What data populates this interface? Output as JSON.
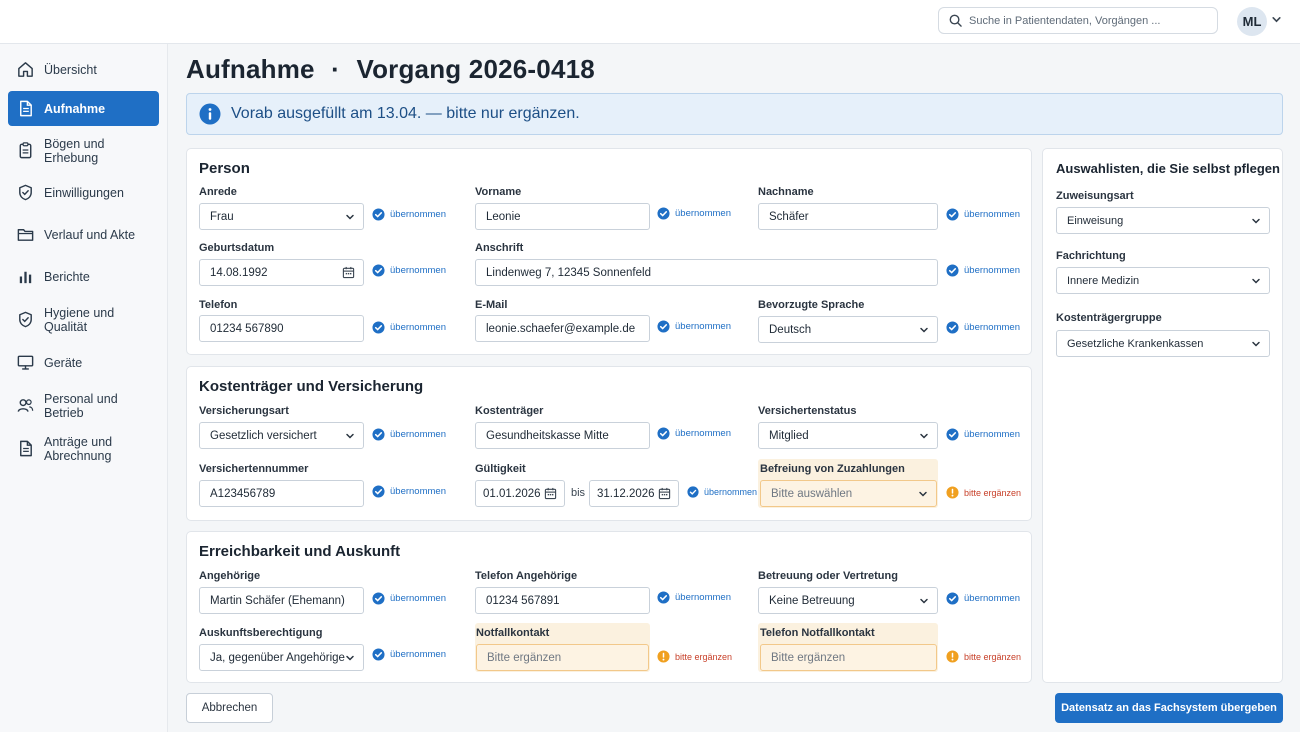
{
  "header": {
    "search_placeholder": "Suche in Patientendaten, Vorgängen ...",
    "avatar_initials": "ML"
  },
  "sidebar": {
    "items": [
      {
        "label": "Übersicht",
        "icon": "home-icon"
      },
      {
        "label": "Aufnahme",
        "icon": "document-icon",
        "active": true
      },
      {
        "label": "Bögen und Erhebung",
        "icon": "clipboard-icon"
      },
      {
        "label": "Einwilligungen",
        "icon": "shield-check-icon"
      },
      {
        "label": "Verlauf und Akte",
        "icon": "folder-icon"
      },
      {
        "label": "Berichte",
        "icon": "bar-chart-icon"
      },
      {
        "label": "Hygiene und Qualität",
        "icon": "shield-check-icon"
      },
      {
        "label": "Geräte",
        "icon": "monitor-icon"
      },
      {
        "label": "Personal und Betrieb",
        "icon": "users-icon"
      },
      {
        "label": "Anträge und Abrechnung",
        "icon": "document-icon"
      }
    ]
  },
  "page": {
    "title_part1": "Aufnahme",
    "separator": "·",
    "title_part2": "Vorgang 2026-0418",
    "info": "Vorab ausgefüllt am 13.04. — bitte nur ergänzen."
  },
  "status": {
    "done": "übernommen",
    "todo": "bitte ergänzen"
  },
  "person": {
    "title": "Person",
    "anrede": {
      "label": "Anrede",
      "value": "Frau"
    },
    "vorname": {
      "label": "Vorname",
      "value": "Leonie"
    },
    "nachname": {
      "label": "Nachname",
      "value": "Schäfer"
    },
    "geburtsdatum": {
      "label": "Geburtsdatum",
      "value": "14.08.1992"
    },
    "anschrift": {
      "label": "Anschrift",
      "value": "Lindenweg 7, 12345 Sonnenfeld"
    },
    "telefon": {
      "label": "Telefon",
      "value": "01234 567890"
    },
    "email": {
      "label": "E-Mail",
      "value": "leonie.schaefer@example.de"
    },
    "sprache": {
      "label": "Bevorzugte Sprache",
      "value": "Deutsch"
    }
  },
  "versicherung": {
    "title": "Kostenträger und Versicherung",
    "art": {
      "label": "Versicherungsart",
      "value": "Gesetzlich versichert"
    },
    "kostentraeger": {
      "label": "Kostenträger",
      "value": "Gesundheitskasse Mitte"
    },
    "status": {
      "label": "Versichertenstatus",
      "value": "Mitglied"
    },
    "nummer": {
      "label": "Versichertennummer",
      "value": "A123456789"
    },
    "gueltigkeit": {
      "label": "Gültigkeit",
      "from": "01.01.2026",
      "bis": "bis",
      "to": "31.12.2026"
    },
    "befreiung": {
      "label": "Befreiung von Zuzahlungen",
      "placeholder": "Bitte auswählen"
    }
  },
  "erreichbarkeit": {
    "title": "Erreichbarkeit und Auskunft",
    "angehoerige": {
      "label": "Angehörige",
      "value": "Martin Schäfer (Ehemann)"
    },
    "tel_angehoerige": {
      "label": "Telefon Angehörige",
      "value": "01234 567891"
    },
    "betreuung": {
      "label": "Betreuung oder Vertretung",
      "value": "Keine Betreuung"
    },
    "auskunft": {
      "label": "Auskunftsberechtigung",
      "value": "Ja, gegenüber Angehörigen"
    },
    "notfallkontakt": {
      "label": "Notfallkontakt",
      "placeholder": "Bitte ergänzen"
    },
    "tel_notfall": {
      "label": "Telefon Notfallkontakt",
      "placeholder": "Bitte ergänzen"
    }
  },
  "auswahllisten": {
    "title": "Auswahlisten, die Sie selbst pflegen",
    "zuweisungsart": {
      "label": "Zuweisungsart",
      "value": "Einweisung"
    },
    "fachrichtung": {
      "label": "Fachrichtung",
      "value": "Innere Medizin"
    },
    "kostentraegergruppe": {
      "label": "Kostenträgergruppe",
      "value": "Gesetzliche Krankenkassen"
    }
  },
  "actions": {
    "cancel": "Abbrechen",
    "submit": "Datensatz an das Fachsystem übergeben"
  },
  "colors": {
    "primary": "#1f6fc5",
    "info_bg": "#e6f0fa",
    "warning": "#f0a020",
    "warning_bg": "#fdf3e3",
    "warning_text": "#c8412a"
  }
}
